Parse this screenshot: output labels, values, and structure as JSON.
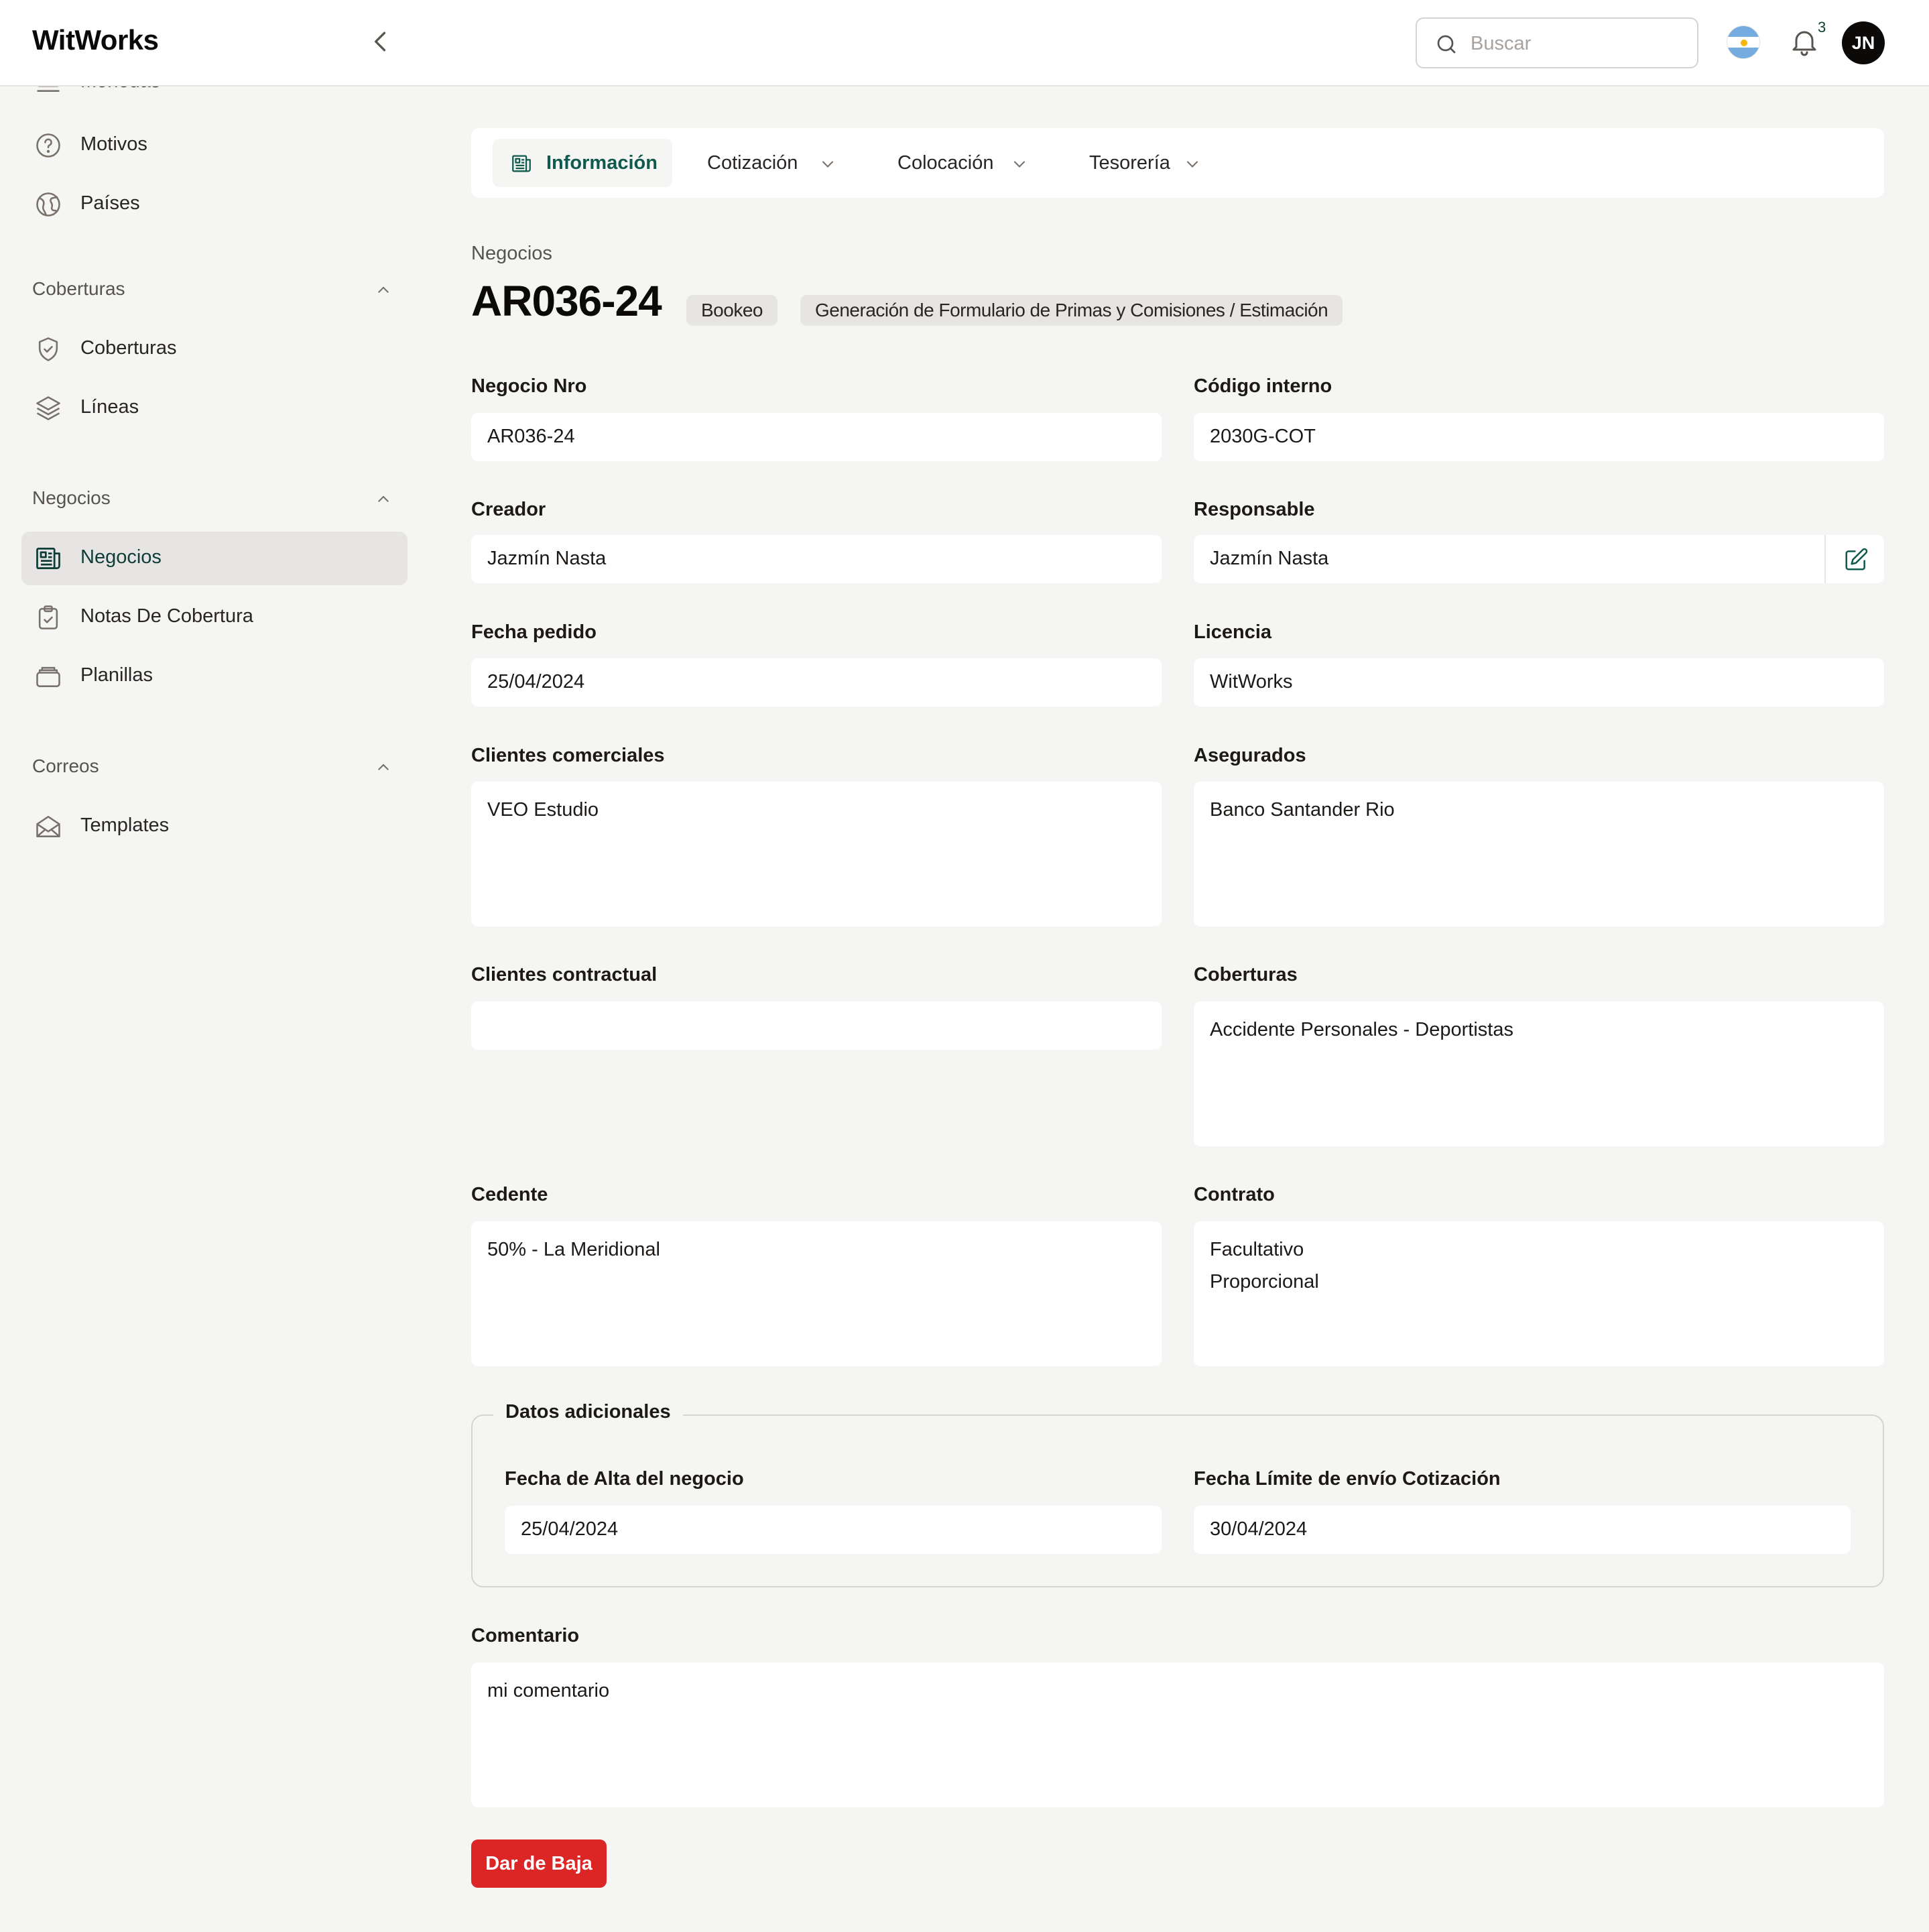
{
  "app": {
    "logo": "WitWorks"
  },
  "header": {
    "search_placeholder": "Buscar",
    "notification_count": "3",
    "avatar_initials": "JN"
  },
  "sidebar": {
    "cut_item": "Monedas",
    "items_top": [
      {
        "label": "Motivos",
        "icon": "help-circle-icon"
      },
      {
        "label": "Países",
        "icon": "globe-icon"
      }
    ],
    "sections": [
      {
        "title": "Coberturas",
        "items": [
          {
            "label": "Coberturas",
            "icon": "shield-check-icon"
          },
          {
            "label": "Líneas",
            "icon": "layers-icon"
          }
        ]
      },
      {
        "title": "Negocios",
        "items": [
          {
            "label": "Negocios",
            "icon": "newspaper-icon",
            "active": true
          },
          {
            "label": "Notas De Cobertura",
            "icon": "clipboard-check-icon"
          },
          {
            "label": "Planillas",
            "icon": "archive-icon"
          }
        ]
      },
      {
        "title": "Correos",
        "items": [
          {
            "label": "Templates",
            "icon": "mail-open-icon"
          }
        ]
      }
    ]
  },
  "tabs": [
    {
      "label": "Información",
      "active": true
    },
    {
      "label": "Cotización"
    },
    {
      "label": "Colocación"
    },
    {
      "label": "Tesorería"
    }
  ],
  "page": {
    "breadcrumb": "Negocios",
    "title": "AR036-24",
    "badges": [
      "Bookeo",
      "Generación de Formulario de Primas y Comisiones / Estimación"
    ]
  },
  "form": {
    "negocio_nro": {
      "label": "Negocio Nro",
      "value": "AR036-24"
    },
    "codigo_interno": {
      "label": "Código interno",
      "value": "2030G-COT"
    },
    "creador": {
      "label": "Creador",
      "value": "Jazmín Nasta"
    },
    "responsable": {
      "label": "Responsable",
      "value": "Jazmín Nasta"
    },
    "fecha_pedido": {
      "label": "Fecha pedido",
      "value": "25/04/2024"
    },
    "licencia": {
      "label": "Licencia",
      "value": "WitWorks"
    },
    "clientes_comerciales": {
      "label": "Clientes comerciales",
      "value": "VEO Estudio"
    },
    "asegurados": {
      "label": "Asegurados",
      "value": "Banco Santander Rio"
    },
    "clientes_contractual": {
      "label": "Clientes contractual",
      "value": ""
    },
    "coberturas": {
      "label": "Coberturas",
      "value": "Accidente Personales - Deportistas"
    },
    "cedente": {
      "label": "Cedente",
      "value": "50% - La Meridional"
    },
    "contrato": {
      "label": "Contrato",
      "value": "Facultativo\nProporcional"
    }
  },
  "datos_adicionales": {
    "legend": "Datos adicionales",
    "fecha_alta": {
      "label": "Fecha de Alta del negocio",
      "value": "25/04/2024"
    },
    "fecha_limite": {
      "label": "Fecha Límite de envío Cotización",
      "value": "30/04/2024"
    }
  },
  "comentario": {
    "label": "Comentario",
    "value": "mi comentario"
  },
  "actions": {
    "dar_de_baja": "Dar de Baja"
  },
  "colors": {
    "accent": "#0f5a4d",
    "danger": "#dc2626",
    "background": "#f5f5f4"
  }
}
